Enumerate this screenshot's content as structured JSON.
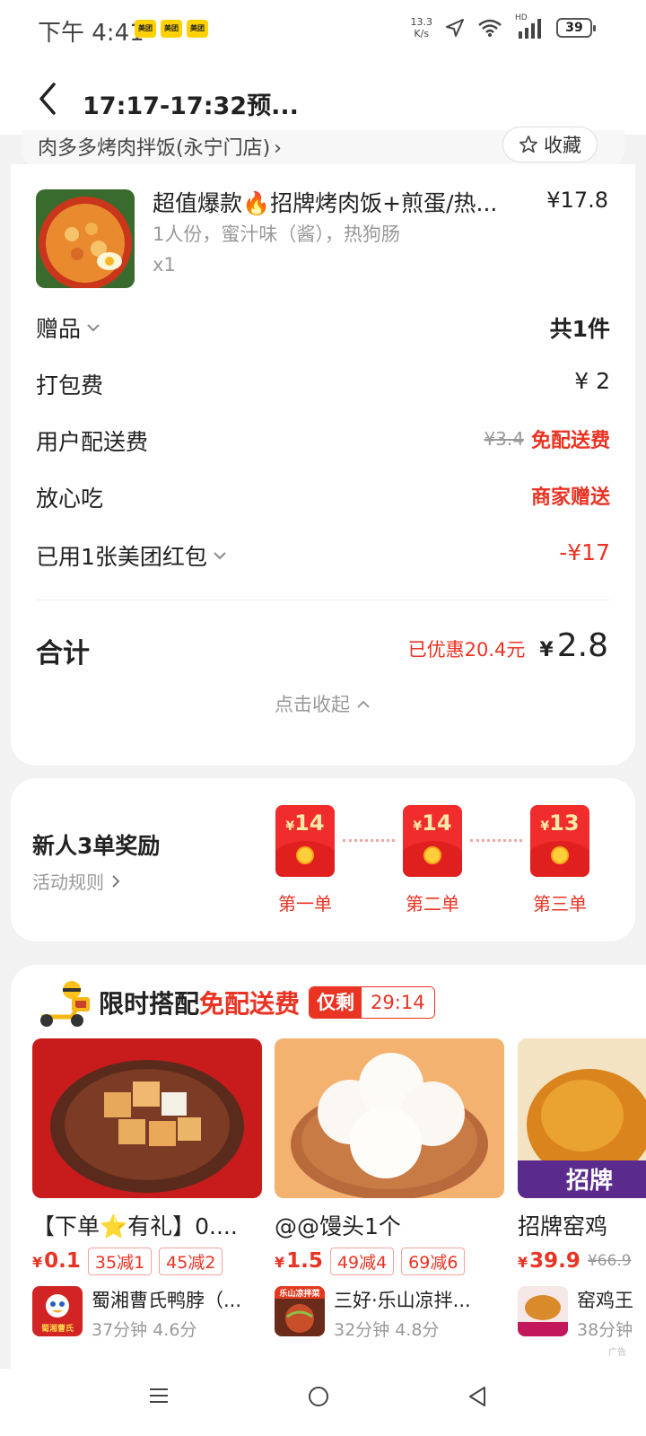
{
  "status_bar": {
    "time": "下午 4:41",
    "badges": [
      "美团",
      "美团",
      "美团"
    ],
    "net_speed_value": "13.3",
    "net_speed_unit": "K/s",
    "signal_label": "HD",
    "battery": "39"
  },
  "header": {
    "title": "17:17-17:32预...",
    "store_name": "肉多多烤肉拌饭(永宁门店)",
    "favorite_label": "收藏"
  },
  "order": {
    "item": {
      "name": "超值爆款🔥招牌烤肉饭+煎蛋/热...",
      "price": "¥17.8",
      "spec": "1人份，蜜汁味（酱），热狗肠",
      "qty": "x1"
    },
    "rows": [
      {
        "label": "赠品",
        "value": "共1件"
      },
      {
        "label": "打包费",
        "value": "¥ 2"
      },
      {
        "label": "用户配送费",
        "original": "¥3.4",
        "value": "免配送费"
      },
      {
        "label": "放心吃",
        "value": "商家赠送"
      },
      {
        "label": "已用1张美团红包",
        "value": "-¥17"
      }
    ],
    "total_label": "合计",
    "discount_text": "已优惠20.4元",
    "total_currency": "¥",
    "total_amount": "2.8",
    "collapse_label": "点击收起"
  },
  "rewards": {
    "title": "新人3单奖励",
    "rule_label": "活动规则",
    "envelopes": [
      {
        "amount": "14",
        "label": "第一单"
      },
      {
        "amount": "14",
        "label": "第二单"
      },
      {
        "amount": "13",
        "label": "第三单"
      }
    ]
  },
  "promo": {
    "title": "限时搭配",
    "title_highlight": "免配送费",
    "timer_label": "仅剩",
    "timer_value": "29:14",
    "products": [
      {
        "name": "【下单⭐有礼】0....",
        "price": "0.1",
        "coupons": [
          "35减1",
          "45减2"
        ],
        "shop": "蜀湘曹氏鸭脖（...",
        "meta": "37分钟 4.6分",
        "logo_text": "蜀湘曹氏"
      },
      {
        "name": "@@馒头1个",
        "price": "1.5",
        "coupons": [
          "49减4",
          "69减6"
        ],
        "shop": "三好·乐山凉拌...",
        "meta": "32分钟 4.8分",
        "logo_text": "乐山凉拌菜"
      },
      {
        "name": "招牌窑鸡",
        "price": "39.9",
        "old_price": "¥66.9",
        "shop": "窑鸡王",
        "meta": "38分钟",
        "banner_text": "招牌"
      }
    ],
    "ad_label": "广告"
  },
  "colors": {
    "accent": "#e93323",
    "background": "#f2f2f2"
  }
}
